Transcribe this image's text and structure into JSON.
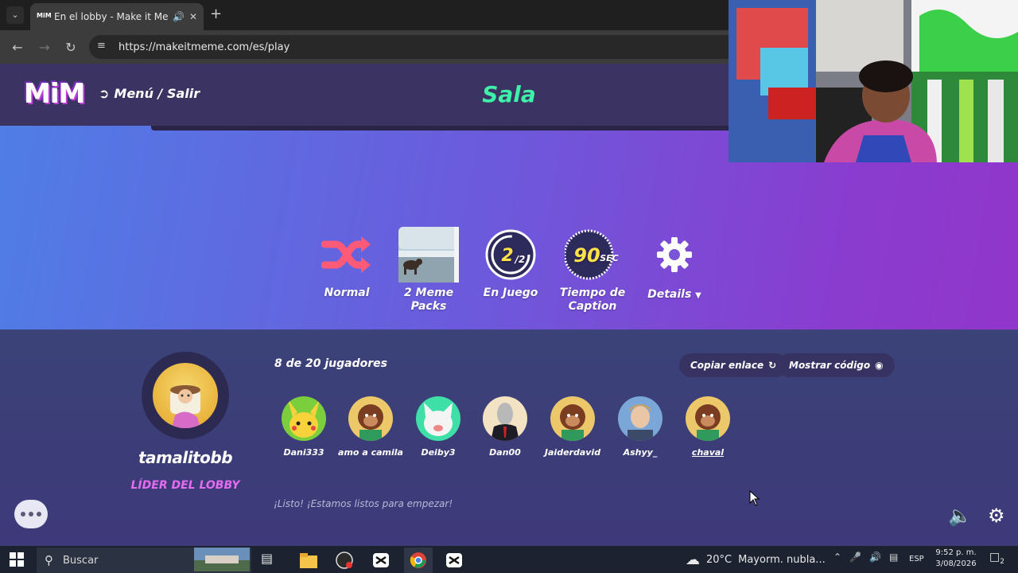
{
  "browser": {
    "tab_title": "En el lobby - Make it Meme",
    "tab_favicon": "MiM",
    "url": "https://makeitmeme.com/es/play"
  },
  "header": {
    "logo": "MiM",
    "menu_label": "Menú / Salir",
    "room_title": "Sala"
  },
  "options": [
    {
      "label": "Normal",
      "icon": "shuffle-icon"
    },
    {
      "label": "2 Meme Packs",
      "icon": "meme-pack-thumbnail"
    },
    {
      "label": "En Juego",
      "icon": "rounds-dial-icon",
      "value": "2",
      "of": "2"
    },
    {
      "label": "Tiempo de Caption",
      "icon": "timer-dial-icon",
      "value": "90",
      "unit": "SEC"
    },
    {
      "label": "Details",
      "icon": "gear-icon"
    }
  ],
  "lobby": {
    "leader_name": "tamalitobb",
    "leader_role": "LÍDER DEL LOBBY",
    "players_count": "8 de  20 jugadores",
    "copy_link": "Copiar enlace",
    "show_code": "Mostrar código",
    "ready_message": "¡Listo! ¡Estamos listos para empezar!",
    "players": [
      {
        "name": "Dani333",
        "avatar": "pikachu"
      },
      {
        "name": "amo a camila",
        "avatar": "monkey"
      },
      {
        "name": "Deiby3",
        "avatar": "white-cat"
      },
      {
        "name": "Dan00",
        "avatar": "stonks-man"
      },
      {
        "name": "Jaiderdavid",
        "avatar": "monkey"
      },
      {
        "name": "Ashyy_",
        "avatar": "woman"
      },
      {
        "name": "chaval",
        "avatar": "monkey"
      }
    ]
  },
  "taskbar": {
    "search_label": "Buscar",
    "weather_temp": "20°C",
    "weather_text": "Mayorm. nubla...",
    "language": "ESP",
    "time": "9:52 p. m.",
    "date": "3/08/2026",
    "notifications": "2"
  },
  "colors": {
    "accent_green": "#3ef0a8",
    "leader_pink": "#e46cf0",
    "header_bg": "#3b3462"
  }
}
